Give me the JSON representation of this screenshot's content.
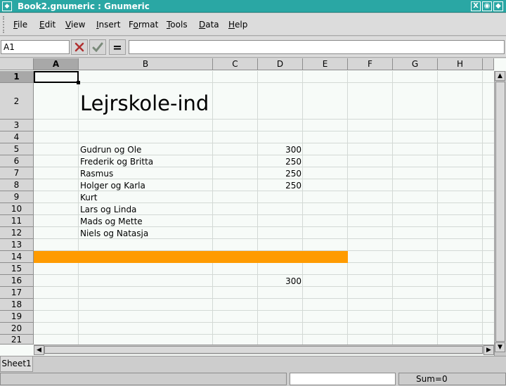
{
  "window": {
    "title": "Book2.gnumeric : Gnumeric"
  },
  "menu": [
    "File",
    "Edit",
    "View",
    "Insert",
    "Format",
    "Tools",
    "Data",
    "Help"
  ],
  "menu_mnemonics": [
    "F",
    "E",
    "V",
    "I",
    "o",
    "T",
    "D",
    "H"
  ],
  "formula": {
    "cell_ref": "A1",
    "cancel_icon": "x-icon",
    "accept_icon": "check-icon",
    "equals_label": "=",
    "value": ""
  },
  "columns": [
    "A",
    "B",
    "C",
    "D",
    "E",
    "F",
    "G",
    "H"
  ],
  "active_cell": {
    "column": "A",
    "row": "1"
  },
  "rows": [
    "1",
    "2",
    "3",
    "4",
    "5",
    "6",
    "7",
    "8",
    "9",
    "10",
    "11",
    "12",
    "13",
    "14",
    "15",
    "16",
    "17",
    "18",
    "19",
    "20",
    "21"
  ],
  "cells": {
    "B2": "Lejrskole-ind",
    "B5": "Gudrun og Ole",
    "B6": "Frederik og Britta",
    "B7": "Rasmus",
    "B8": "Holger og Karla",
    "B9": "Kurt",
    "B10": "Lars og Linda",
    "B11": "Mads og Mette",
    "B12": "Niels og Natasja",
    "D5": "300",
    "D6": "250",
    "D7": "250",
    "D8": "250",
    "D16": "300"
  },
  "highlight": {
    "row": "14",
    "from_column": "A",
    "to_column": "E",
    "color": "#ff9b00"
  },
  "sheet_tabs": [
    "Sheet1"
  ],
  "status": {
    "sum": "Sum=0"
  }
}
